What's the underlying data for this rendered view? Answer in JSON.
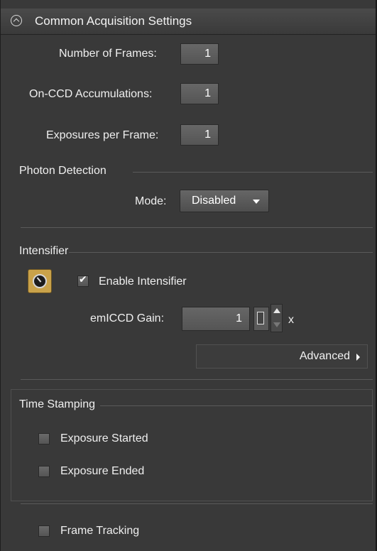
{
  "header": {
    "title": "Common Acquisition Settings",
    "icon": "collapse-up-icon"
  },
  "acquisition": {
    "frames_label": "Number of Frames:",
    "frames_value": "1",
    "accumulations_label": "On-CCD Accumulations:",
    "accumulations_value": "1",
    "exposures_label": "Exposures per Frame:",
    "exposures_value": "1"
  },
  "photon": {
    "title": "Photon Detection",
    "mode_label": "Mode:",
    "mode_value": "Disabled"
  },
  "intensifier": {
    "title": "Intensifier",
    "enable_label": "Enable Intensifier",
    "enable_checked": true,
    "gain_label": "emICCD Gain:",
    "gain_value": "1",
    "gain_unit": "x",
    "advanced_label": "Advanced"
  },
  "timestamping": {
    "title": "Time Stamping",
    "exposure_started": "Exposure Started",
    "exposure_ended": "Exposure Ended"
  },
  "tracking": {
    "frame_tracking": "Frame Tracking"
  },
  "colors": {
    "panel_bg": "#393939",
    "accent_icon": "#c9a24a"
  }
}
